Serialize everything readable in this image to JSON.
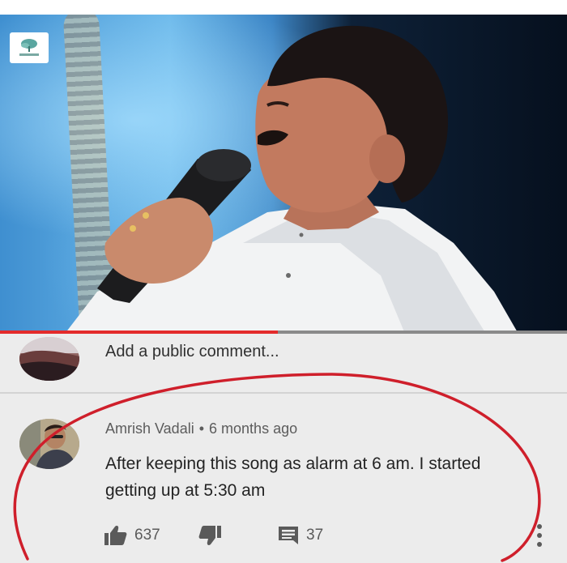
{
  "video": {
    "channel_logo_icon": "leaf-logo-icon",
    "progress_fraction": 0.49
  },
  "comment_box": {
    "placeholder": "Add a public comment..."
  },
  "comment": {
    "author": "Amrish Vadali",
    "separator": "•",
    "time": "6 months ago",
    "text": "After keeping this song as alarm at 6 am. I started getting up at 5:30 am",
    "likes": "637",
    "replies": "37",
    "icons": [
      "thumbs-up-icon",
      "thumbs-down-icon",
      "reply-icon",
      "more-vert-icon"
    ]
  },
  "colors": {
    "progress": "#e32b2b",
    "annotation_circle": "#cf1f2b",
    "icon": "#5a5a5a"
  }
}
